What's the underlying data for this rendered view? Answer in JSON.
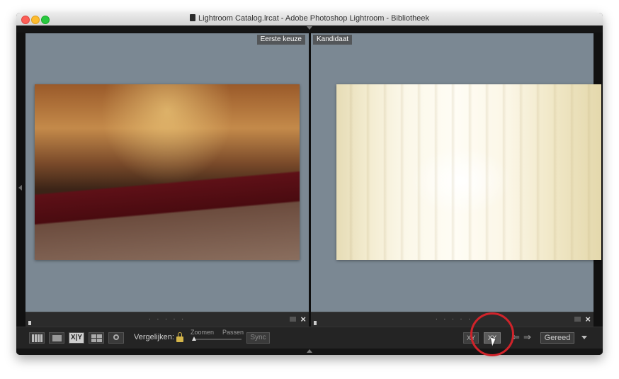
{
  "window": {
    "title": "Lightroom Catalog.lrcat - Adobe Photoshop Lightroom - Bibliotheek",
    "title_icon": "document-icon"
  },
  "compare": {
    "select_badge": "Eerste keuze",
    "candidate_badge": "Kandidaat",
    "select_photo": "bride-on-staircase-photo",
    "candidate_photo": "bride-in-curtains-photo"
  },
  "pane_footer": {
    "dots": ". . . . .",
    "close_glyph": "×"
  },
  "toolbar": {
    "xy_label": "X|Y",
    "compare_label": "Vergelijken:",
    "zoom_label": "Zoomen",
    "fit_label": "Passen",
    "sync_label": "Sync",
    "swap_label": "XY",
    "promote_label": "XY",
    "prev_glyph": "⇐",
    "next_glyph": "⇒",
    "done_label": "Gereed"
  },
  "colors": {
    "highlight_circle": "#d0232a",
    "pane_background": "#7b8893",
    "toolbar_background": "#242424"
  }
}
